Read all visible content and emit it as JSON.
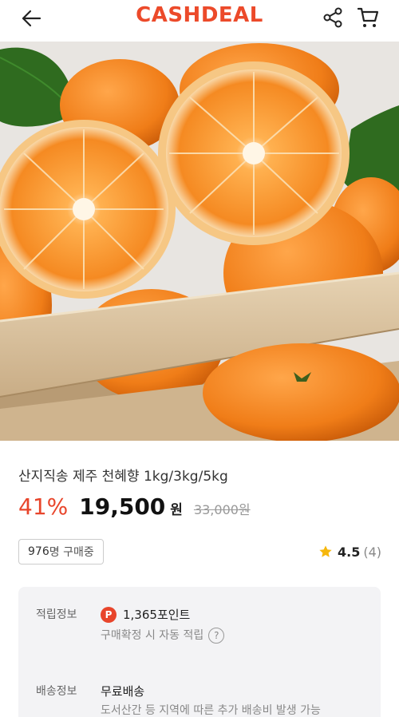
{
  "header": {
    "logo": "CASHDEAL",
    "brand_color": "#ec4a2a"
  },
  "icons": {
    "back": "arrow-left-icon",
    "share": "share-icon",
    "cart": "cart-icon"
  },
  "product": {
    "title": "산지직송 제주 천혜향 1kg/3kg/5kg",
    "discount": "41%",
    "price": "19,500",
    "currency": "원",
    "original_price": "33,000원"
  },
  "buyers": {
    "count": "976",
    "label": "명 구매중"
  },
  "rating": {
    "score": "4.5",
    "count": "(4)"
  },
  "info": {
    "reward_label": "적립정보",
    "reward_badge": "P",
    "reward_value": "1,365포인트",
    "reward_sub": "구매확정 시 자동 적립",
    "help_symbol": "?",
    "shipping_label": "배송정보",
    "shipping_value": "무료배송",
    "shipping_sub": "도서산간 등 지역에 따른 추가 배송비 발생 가능"
  }
}
